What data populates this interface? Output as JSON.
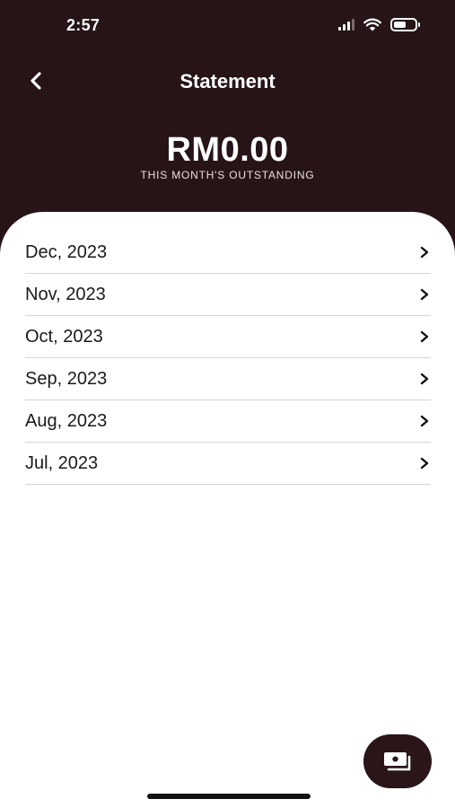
{
  "status_bar": {
    "time": "2:57"
  },
  "header": {
    "title": "Statement",
    "amount": "RM0.00",
    "amount_caption": "THIS MONTH'S OUTSTANDING"
  },
  "statements": [
    {
      "label": "Dec, 2023"
    },
    {
      "label": "Nov, 2023"
    },
    {
      "label": "Oct, 2023"
    },
    {
      "label": "Sep, 2023"
    },
    {
      "label": "Aug, 2023"
    },
    {
      "label": "Jul, 2023"
    }
  ],
  "icons": {
    "back": "chevron-left-icon",
    "row": "chevron-right-icon",
    "fab": "cash-icon"
  },
  "colors": {
    "header_bg": "#261417",
    "fab_bg": "#2a1518",
    "text_primary": "#1a1a1a",
    "divider": "#d4d4d4"
  }
}
